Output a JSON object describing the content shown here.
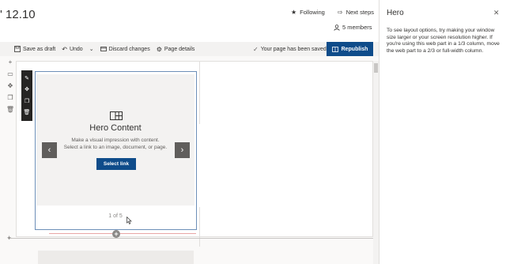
{
  "header": {
    "site_title": "' 12.10",
    "following_label": "Following",
    "next_steps_label": "Next steps",
    "members_label": "5 members"
  },
  "toolbar": {
    "save_draft_label": "Save as draft",
    "undo_label": "Undo",
    "discard_label": "Discard changes",
    "page_details_label": "Page details",
    "saved_status": "Your page has been saved",
    "republish_label": "Republish"
  },
  "webpart": {
    "title": "Hero Content",
    "description_line1": "Make a visual impression with content.",
    "description_line2": "Select a link to an image, document, or page.",
    "select_link_label": "Select link",
    "prev_glyph": "‹",
    "next_glyph": "›",
    "pager": "1 of 5"
  },
  "panel": {
    "title": "Hero",
    "close_glyph": "✕",
    "text": "To see layout options, try making your window size larger or your screen resolution higher. If you're using this web part in a 1/3 column, move the web part to a 2/3 or full-width column."
  },
  "colors": {
    "accent": "#0f4c8a",
    "toolbar_bg": "#f3f2f1"
  },
  "icons": {
    "following": "star-icon",
    "next_steps": "arrow-right-icon",
    "members": "person-icon",
    "save": "floppy-icon",
    "undo": "undo-icon",
    "discard": "discard-icon",
    "page_details": "gear-icon",
    "saved": "checkmark-icon",
    "republish": "book-icon",
    "hero": "grid-icon"
  }
}
